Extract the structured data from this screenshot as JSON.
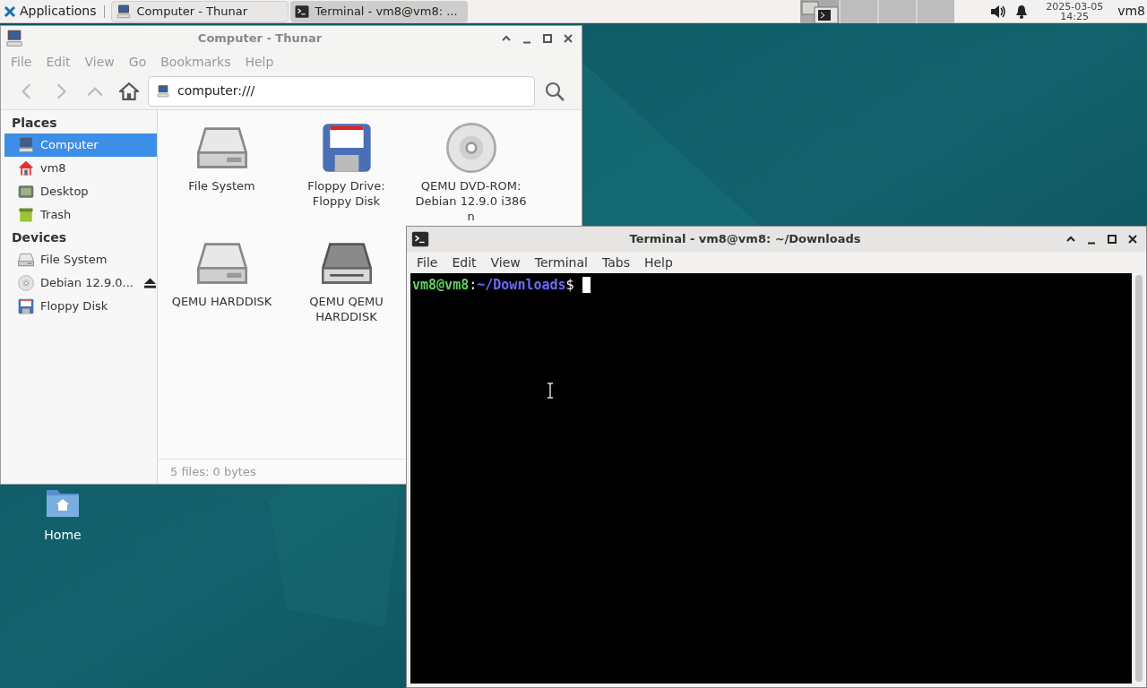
{
  "taskbar": {
    "apps_menu": "Applications",
    "tasks": [
      {
        "title": "Computer - Thunar",
        "kind": "files",
        "selected": false
      },
      {
        "title": "Terminal - vm8@vm8: ...",
        "kind": "terminal",
        "selected": true
      }
    ],
    "clock": {
      "date": "2025-03-05",
      "time": "14:25"
    },
    "user": "vm8"
  },
  "desktop_icons": [
    {
      "label": "Home"
    }
  ],
  "file_manager": {
    "title": "Computer - Thunar",
    "menu": [
      "File",
      "Edit",
      "View",
      "Go",
      "Bookmarks",
      "Help"
    ],
    "location": "computer:///",
    "sidebar": [
      {
        "heading": "Places",
        "items": [
          {
            "label": "Computer",
            "kind": "computer",
            "selected": true,
            "eject": false
          },
          {
            "label": "vm8",
            "kind": "home",
            "selected": false,
            "eject": false
          },
          {
            "label": "Desktop",
            "kind": "desktop",
            "selected": false,
            "eject": false
          },
          {
            "label": "Trash",
            "kind": "trash",
            "selected": false,
            "eject": false
          }
        ]
      },
      {
        "heading": "Devices",
        "items": [
          {
            "label": "File System",
            "kind": "drive",
            "selected": false,
            "eject": false
          },
          {
            "label": "Debian 12.9.0...",
            "kind": "disc",
            "selected": false,
            "eject": true
          },
          {
            "label": "Floppy Disk",
            "kind": "floppy",
            "selected": false,
            "eject": false
          }
        ]
      }
    ],
    "files": [
      {
        "label": "File System",
        "kind": "drive"
      },
      {
        "label": "Floppy Drive: Floppy Disk",
        "kind": "floppy"
      },
      {
        "label": "QEMU DVD-ROM: Debian 12.9.0 i386 n",
        "kind": "disc"
      },
      {
        "label": "QEMU HARDDISK",
        "kind": "drive"
      },
      {
        "label": "QEMU QEMU HARDDISK",
        "kind": "drive-dark"
      }
    ],
    "status": "5 files: 0 bytes"
  },
  "terminal": {
    "title": "Terminal - vm8@vm8: ~/Downloads",
    "menu": [
      "File",
      "Edit",
      "View",
      "Terminal",
      "Tabs",
      "Help"
    ],
    "prompt": {
      "user_host": "vm8@vm8",
      "separator": ":",
      "path": "~/Downloads",
      "symbol": "$"
    }
  }
}
